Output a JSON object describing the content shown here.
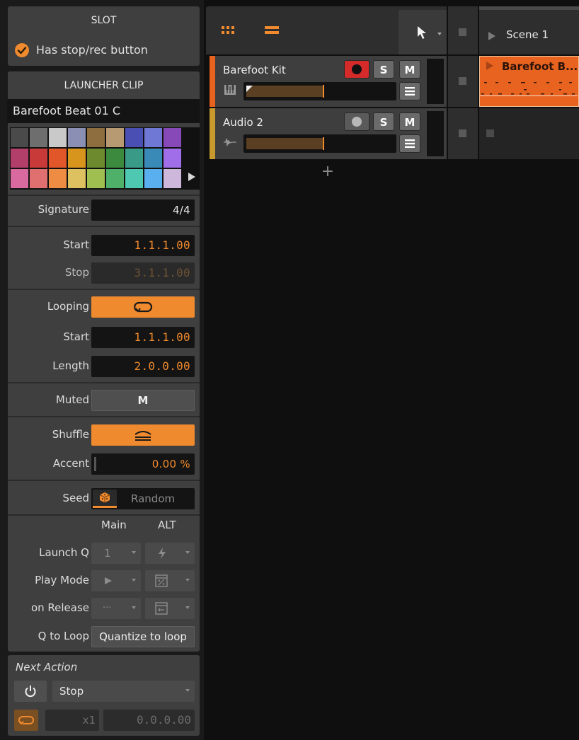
{
  "inspector": {
    "slot": {
      "title": "SLOT",
      "option_label": "Has stop/rec button",
      "option_checked": true
    },
    "launcher_clip": {
      "title": "LAUNCHER CLIP",
      "clip_name": "Barefoot Beat 01 C",
      "palette": [
        "#4a4a4a",
        "#6e6e6e",
        "#c9c9c9",
        "#8a8fb3",
        "#8e6e3e",
        "#b89a72",
        "#4a4fb3",
        "#6f78d4",
        "#8748b8",
        "#b23e6a",
        "#c83a3a",
        "#e2572a",
        "#d8951e",
        "#6e8a2e",
        "#3b8a3e",
        "#3a9a88",
        "#3a8ab8",
        "#a06ee8",
        "#d86aa0",
        "#e07070",
        "#ee8c44",
        "#ddc060",
        "#9fc050",
        "#4fb06a",
        "#4ec8b0",
        "#5ab0ee",
        "#cdb8dc"
      ],
      "signature_label": "Signature",
      "signature_value": "4/4",
      "start_label": "Start",
      "start_value": "1.1.1.00",
      "stop_label": "Stop",
      "stop_value": "3.1.1.00",
      "looping_label": "Looping",
      "loop_start_label": "Start",
      "loop_start_value": "1.1.1.00",
      "length_label": "Length",
      "length_value": "2.0.0.00",
      "muted_label": "Muted",
      "muted_button": "M",
      "shuffle_label": "Shuffle",
      "accent_label": "Accent",
      "accent_value": "0.00 %",
      "accent_level": 0,
      "seed_label": "Seed",
      "seed_value": "Random",
      "col_main": "Main",
      "col_alt": "ALT",
      "launch_q_label": "Launch Q",
      "launch_q_main": "1",
      "play_mode_label": "Play Mode",
      "on_release_label": "on Release",
      "on_release_main": "···",
      "q_to_loop_label": "Q to Loop",
      "q_to_loop_button": "Quantize to loop"
    },
    "next_action": {
      "title": "Next Action",
      "action_value": "Stop",
      "count_value": "x1",
      "time_value": "0.0.0.00"
    }
  },
  "launcher": {
    "scene_label": "Scene 1",
    "tracks": [
      {
        "name": "Barefoot Kit",
        "color": "#e8631f",
        "armed": true,
        "solo_label": "S",
        "mute_label": "M",
        "clip_name": "Barefoot B...",
        "clip_color": "#e8631f"
      },
      {
        "name": "Audio 2",
        "color": "#c89a2e",
        "armed": false,
        "solo_label": "S",
        "mute_label": "M"
      }
    ],
    "add_track_glyph": "+"
  },
  "colors": {
    "accent": "#f08a2c",
    "panel": "#3f3f3f",
    "record_red": "#d42a2a"
  }
}
